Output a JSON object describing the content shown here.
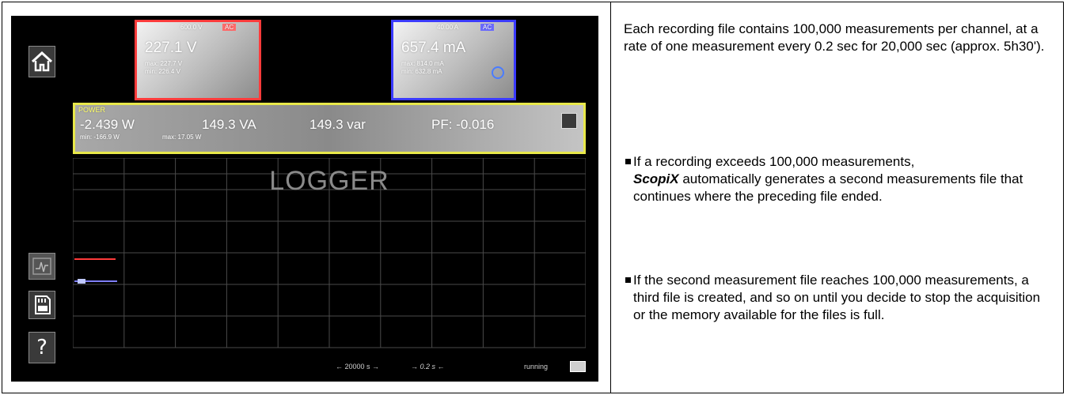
{
  "device": {
    "ch1": {
      "range": "600.0 V",
      "coupling": "AC",
      "value": "227.1 V",
      "max": "max: 227.7 V",
      "min": "min: 226.4 V"
    },
    "ch2": {
      "range": "40.00 A",
      "coupling": "AC",
      "value": "657.4 mA",
      "max": "max: 814.0 mA",
      "min": "min: 632.8 mA"
    },
    "power": {
      "title": "POWER",
      "active": "-2.439 W",
      "apparent": "149.3 VA",
      "reactive": "149.3 var",
      "pf": "PF: -0.016",
      "min_active": "min: -166.9 W",
      "max_active": "max: 17.05 W"
    },
    "mode_label": "LOGGER",
    "footer": {
      "duration": "← 20000 s →",
      "interval": "→ 0.2 s ←",
      "status": "running"
    },
    "icons": [
      "home-icon",
      "trace-icon",
      "sd-card-icon",
      "help-icon",
      "power-settings-icon",
      "record-icon"
    ],
    "colors": {
      "ch1": "#ff3b3b",
      "ch2": "#3b3bff",
      "power": "#e8e84a"
    }
  },
  "text": {
    "intro": "Each recording file contains 100,000 measurements per channel, at a rate of one measurement every 0.2 sec for 20,000 sec (approx. 5h30').",
    "bullet1_brand": "ScopiX",
    "bullet1_start": "If a recording exceeds 100,000 measurements,",
    "bullet1_end": " automatically generates a second measurements file that continues where the preceding file ended.",
    "bullet2": "If the second measurement file reaches 100,000 measurements, a third file is created, and so on until you decide to stop the acquisition or the memory available for the files is full."
  }
}
